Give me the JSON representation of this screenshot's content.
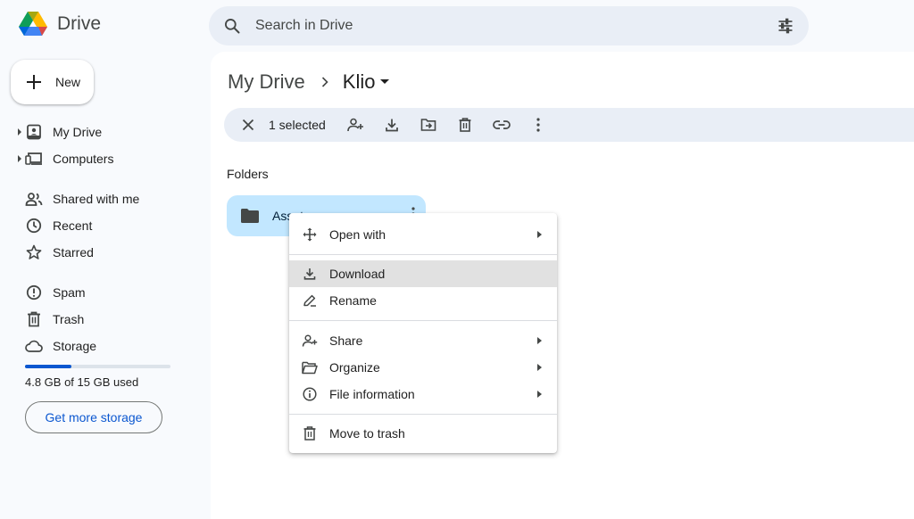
{
  "app": {
    "title": "Drive"
  },
  "search": {
    "placeholder": "Search in Drive",
    "value": ""
  },
  "sidebar": {
    "new_label": "New",
    "items": [
      {
        "label": "My Drive",
        "icon": "my-drive-icon",
        "expandable": true
      },
      {
        "label": "Computers",
        "icon": "computers-icon",
        "expandable": true
      },
      {
        "label": "Shared with me",
        "icon": "shared-icon"
      },
      {
        "label": "Recent",
        "icon": "clock-icon"
      },
      {
        "label": "Starred",
        "icon": "star-icon"
      },
      {
        "label": "Spam",
        "icon": "spam-icon"
      },
      {
        "label": "Trash",
        "icon": "trash-icon"
      },
      {
        "label": "Storage",
        "icon": "cloud-icon"
      }
    ],
    "storage_used_fraction": 0.32,
    "storage_text": "4.8 GB of 15 GB used",
    "get_more_storage": "Get more storage"
  },
  "breadcrumb": {
    "root": "My Drive",
    "current": "Klio"
  },
  "selection": {
    "count_label": "1 selected"
  },
  "folders": {
    "section_label": "Folders",
    "items": [
      {
        "name": "Assets"
      }
    ]
  },
  "context_menu": {
    "items": [
      {
        "label": "Open with",
        "icon": "open-with-icon",
        "submenu": true
      },
      {
        "label": "Download",
        "icon": "download-icon",
        "highlighted": true
      },
      {
        "label": "Rename",
        "icon": "rename-icon"
      },
      {
        "label": "Share",
        "icon": "share-icon",
        "submenu": true
      },
      {
        "label": "Organize",
        "icon": "organize-icon",
        "submenu": true
      },
      {
        "label": "File information",
        "icon": "info-icon",
        "submenu": true
      },
      {
        "label": "Move to trash",
        "icon": "trash-icon"
      }
    ]
  },
  "colors": {
    "accent": "#0b57d0",
    "selected_folder": "#c2e7ff",
    "search_bg": "#e9eef6",
    "menu_highlight": "#e1e1e1"
  }
}
